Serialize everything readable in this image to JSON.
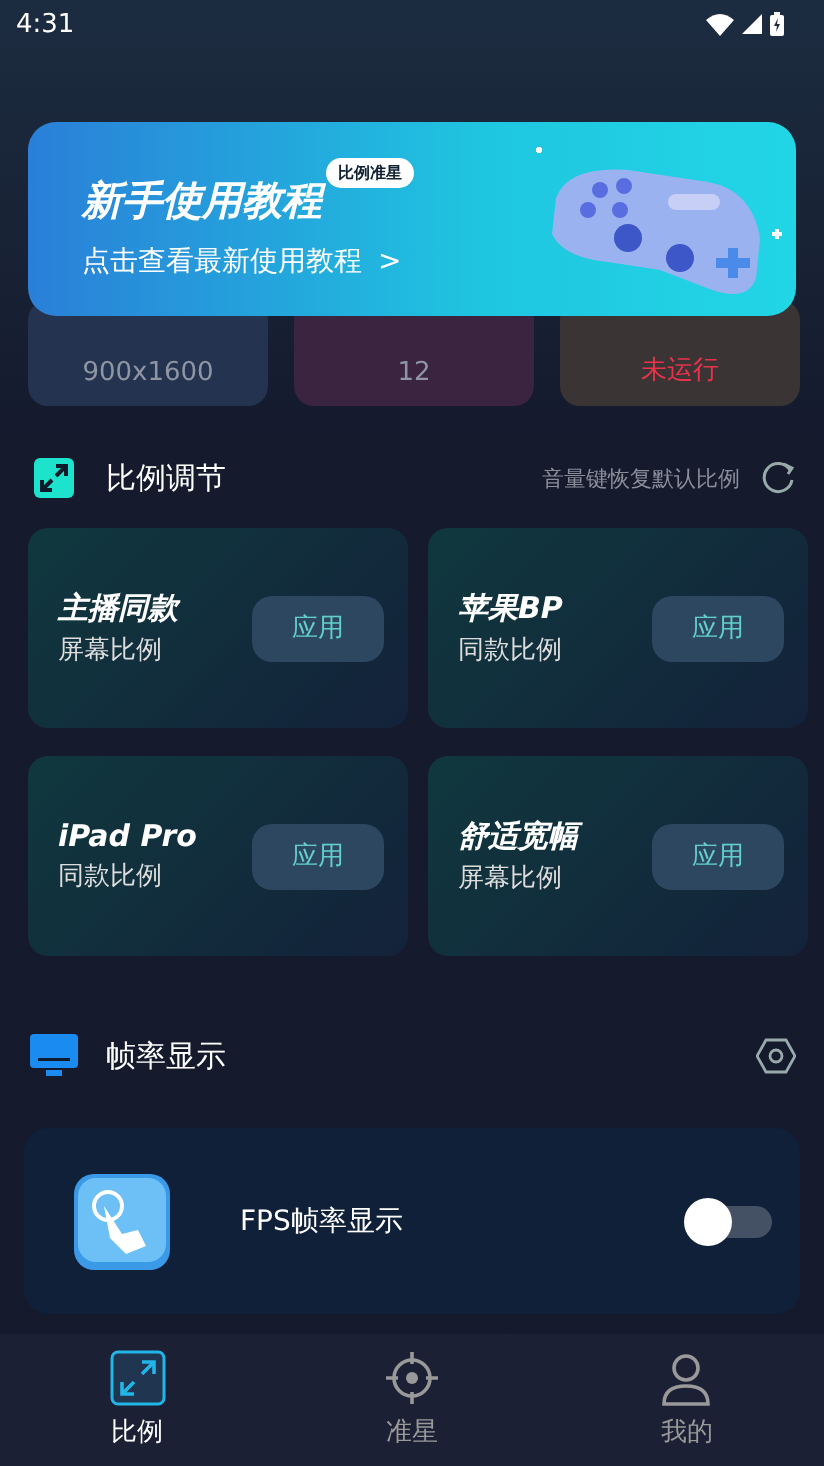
{
  "status_bar": {
    "time": "4:31"
  },
  "banner": {
    "title": "新手使用教程",
    "badge": "比例准星",
    "link": "点击查看最新使用教程",
    "chevron": ">"
  },
  "stats": [
    {
      "value": "900x1600",
      "kind": "normal"
    },
    {
      "value": "12",
      "kind": "normal"
    },
    {
      "value": "未运行",
      "kind": "alert"
    }
  ],
  "ratio_section": {
    "title": "比例调节",
    "hint": "音量键恢复默认比例"
  },
  "presets": [
    {
      "name": "主播同款",
      "sub": "屏幕比例",
      "button": "应用"
    },
    {
      "name": "苹果BP",
      "sub": "同款比例",
      "button": "应用"
    },
    {
      "name": "iPad Pro",
      "sub": "同款比例",
      "button": "应用"
    },
    {
      "name": "舒适宽幅",
      "sub": "屏幕比例",
      "button": "应用"
    }
  ],
  "fps_section": {
    "title": "帧率显示"
  },
  "fps_row": {
    "label": "FPS帧率显示",
    "on": false
  },
  "nav": [
    {
      "label": "比例",
      "kind": "ratio",
      "selected": true
    },
    {
      "label": "准星",
      "kind": "crosshair",
      "selected": false
    },
    {
      "label": "我的",
      "kind": "profile",
      "selected": false
    }
  ]
}
